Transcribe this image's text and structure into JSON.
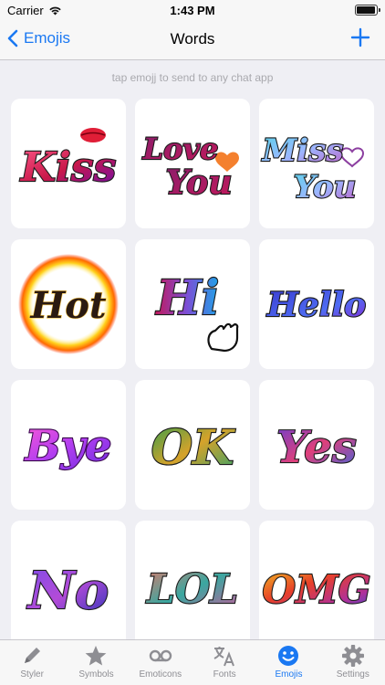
{
  "status_bar": {
    "carrier": "Carrier",
    "time": "1:43 PM"
  },
  "nav": {
    "back_label": "Emojis",
    "title": "Words",
    "add_icon": "plus-icon"
  },
  "hint": "tap emojj to send to any chat app",
  "tiles": [
    {
      "word": "Kiss",
      "decoration": "lips-icon"
    },
    {
      "word": "Love You",
      "line1": "Love",
      "line2": "You",
      "decoration": "heart-icon"
    },
    {
      "word": "Miss You",
      "line1": "Miss",
      "line2": "You",
      "decoration": "heart-outline-icon"
    },
    {
      "word": "Hot",
      "decoration": "fire-ring-icon"
    },
    {
      "word": "Hi",
      "decoration": "waving-hand-icon"
    },
    {
      "word": "Hello"
    },
    {
      "word": "Bye"
    },
    {
      "word": "OK"
    },
    {
      "word": "Yes"
    },
    {
      "word": "No"
    },
    {
      "word": "LOL"
    },
    {
      "word": "OMG"
    }
  ],
  "tab_bar": {
    "tabs": [
      {
        "label": "Styler",
        "icon": "pencil-icon"
      },
      {
        "label": "Symbols",
        "icon": "star-icon"
      },
      {
        "label": "Emoticons",
        "icon": "voicemail-icon"
      },
      {
        "label": "Fonts",
        "icon": "translate-icon"
      },
      {
        "label": "Emojis",
        "icon": "smiley-icon",
        "active": true
      },
      {
        "label": "Settings",
        "icon": "gear-icon"
      }
    ]
  },
  "colors": {
    "accent": "#1a78f2",
    "background": "#efeff4",
    "inactive_tab": "#8e8e93"
  }
}
